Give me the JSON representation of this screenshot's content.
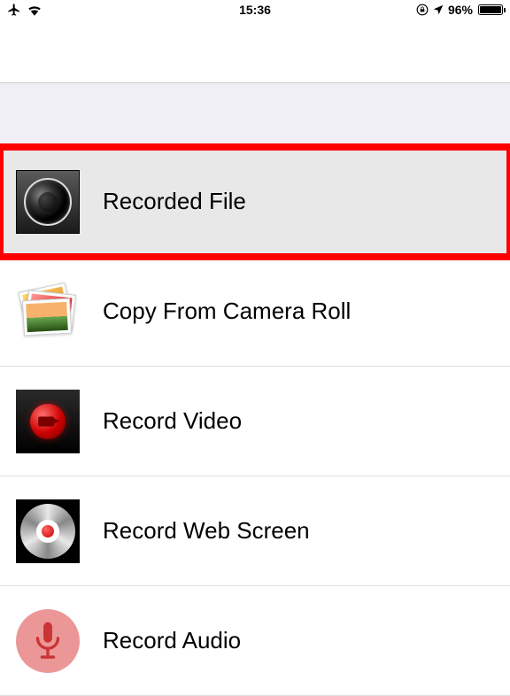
{
  "status": {
    "time": "15:36",
    "battery_text": "96%"
  },
  "menu": {
    "items": [
      {
        "label": "Recorded File",
        "icon": "camera-lens-icon",
        "highlighted": true
      },
      {
        "label": "Copy From Camera Roll",
        "icon": "photo-stack-icon",
        "highlighted": false
      },
      {
        "label": "Record Video",
        "icon": "record-video-icon",
        "highlighted": false
      },
      {
        "label": "Record Web Screen",
        "icon": "disc-icon",
        "highlighted": false
      },
      {
        "label": "Record Audio",
        "icon": "microphone-icon",
        "highlighted": false
      }
    ]
  }
}
